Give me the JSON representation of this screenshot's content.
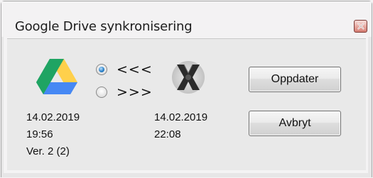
{
  "window": {
    "title": "Google Drive synkronisering"
  },
  "sync": {
    "options": [
      {
        "label": "<<<",
        "checked": true
      },
      {
        "label": ">>>",
        "checked": false
      }
    ]
  },
  "local": {
    "date": "14.02.2019",
    "time": "19:56",
    "version": "Ver. 2 (2)"
  },
  "remote": {
    "date": "14.02.2019",
    "time": "22:08"
  },
  "buttons": {
    "update_label": "Oppdater",
    "cancel_label": "Avbryt"
  },
  "icons": {
    "drive": "google-drive-icon",
    "remote": "x-logo-icon",
    "close": "close-icon"
  },
  "colors": {
    "drive_green": "#1fa463",
    "drive_yellow": "#ffd04b",
    "drive_blue": "#4688f4",
    "radio_accent": "#2c82c9",
    "close_button": "#d67d73"
  }
}
